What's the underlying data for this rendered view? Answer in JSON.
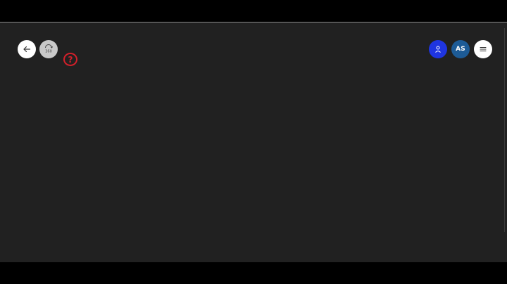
{
  "toolbar": {
    "left": {
      "back_icon": "arrow-left-icon",
      "rotate_icon": "rotate-360-icon",
      "rotate_label": "360",
      "help_icon": "help-question-icon",
      "help_label": "?"
    },
    "right": {
      "user_icon": "person-icon",
      "avatar_initials": "AS",
      "menu_icon": "hamburger-menu-icon"
    }
  },
  "colors": {
    "canvas": "#212121",
    "letterbox": "#000000",
    "user_button": "#1f35e0",
    "avatar": "#1d5b96",
    "help_marker": "#d4202a"
  }
}
